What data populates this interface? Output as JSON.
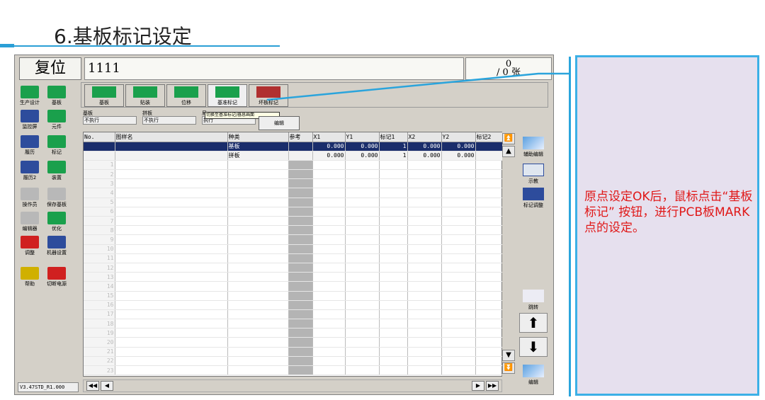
{
  "slide": {
    "title": "6.基板标记设定"
  },
  "topbar": {
    "reset_label": "复位",
    "program_name": "1111",
    "counter_value": "0",
    "counter_unit": "/ 0 张"
  },
  "left_toolbar": [
    {
      "label": "生产设计",
      "icon": "production-design-icon",
      "color": "#1aa04c"
    },
    {
      "label": "基板",
      "icon": "board-icon",
      "color": "#1aa04c"
    },
    {
      "label": "监控屏",
      "icon": "monitor-icon",
      "color": "#2d4c9c"
    },
    {
      "label": "元件",
      "icon": "component-icon",
      "color": "#1aa04c"
    },
    {
      "label": "履历",
      "icon": "history-icon",
      "color": "#2d4c9c"
    },
    {
      "label": "标记",
      "icon": "mark-icon",
      "color": "#1aa04c"
    },
    {
      "label": "履历2",
      "icon": "history2-icon",
      "color": "#2d4c9c"
    },
    {
      "label": "装置",
      "icon": "device-icon",
      "color": "#1aa04c"
    },
    {
      "label": "操作员",
      "icon": "operator-icon",
      "color": "#b8b8b8"
    },
    {
      "label": "保存基板",
      "icon": "save-board-icon",
      "color": "#b8b8b8"
    },
    {
      "label": "编辑器",
      "icon": "editor-icon",
      "color": "#b8b8b8"
    },
    {
      "label": "优化",
      "icon": "optimize-icon",
      "color": "#1aa04c"
    },
    {
      "label": "调整",
      "icon": "adjust-icon",
      "color": "#d02020"
    },
    {
      "label": "机器设置",
      "icon": "machine-settings-icon",
      "color": "#2d4c9c"
    },
    {
      "label": "帮助",
      "icon": "help-icon",
      "color": "#d0b000"
    },
    {
      "label": "切断电源",
      "icon": "power-off-icon",
      "color": "#d02020"
    }
  ],
  "tabs": [
    {
      "label": "基板",
      "icon": "board-tab-icon"
    },
    {
      "label": "贴装",
      "icon": "placement-tab-icon"
    },
    {
      "label": "位移",
      "icon": "offset-tab-icon"
    },
    {
      "label": "基准标记",
      "icon": "fiducial-tab-icon"
    },
    {
      "label": "坏板标记",
      "icon": "bad-mark-tab-icon"
    }
  ],
  "info": {
    "board_label": "基板",
    "board_value": "不执行",
    "panel_label": "拼板",
    "panel_value": "不执行",
    "local_label": "局",
    "local_value": "执行",
    "edit_label": "编辑",
    "tooltip": "切换至基准标记/器息画面"
  },
  "grid": {
    "headers": [
      "No.",
      "图样名",
      "种类",
      "参考",
      "X1",
      "Y1",
      "标记1",
      "X2",
      "Y2",
      "标记2"
    ],
    "rows": [
      [
        "",
        "",
        "基板",
        "",
        "0.000",
        "0.000",
        "1",
        "0.000",
        "0.000",
        ""
      ],
      [
        "",
        "",
        "拼板",
        "",
        "0.000",
        "0.000",
        "1",
        "0.000",
        "0.000",
        ""
      ],
      [
        "1",
        "",
        "",
        "",
        "",
        "",
        "",
        "",
        "",
        ""
      ],
      [
        "2",
        "",
        "",
        "",
        "",
        "",
        "",
        "",
        "",
        ""
      ],
      [
        "3",
        "",
        "",
        "",
        "",
        "",
        "",
        "",
        "",
        ""
      ],
      [
        "4",
        "",
        "",
        "",
        "",
        "",
        "",
        "",
        "",
        ""
      ],
      [
        "5",
        "",
        "",
        "",
        "",
        "",
        "",
        "",
        "",
        ""
      ],
      [
        "6",
        "",
        "",
        "",
        "",
        "",
        "",
        "",
        "",
        ""
      ],
      [
        "7",
        "",
        "",
        "",
        "",
        "",
        "",
        "",
        "",
        ""
      ],
      [
        "8",
        "",
        "",
        "",
        "",
        "",
        "",
        "",
        "",
        ""
      ],
      [
        "9",
        "",
        "",
        "",
        "",
        "",
        "",
        "",
        "",
        ""
      ],
      [
        "10",
        "",
        "",
        "",
        "",
        "",
        "",
        "",
        "",
        ""
      ],
      [
        "11",
        "",
        "",
        "",
        "",
        "",
        "",
        "",
        "",
        ""
      ],
      [
        "12",
        "",
        "",
        "",
        "",
        "",
        "",
        "",
        "",
        ""
      ],
      [
        "13",
        "",
        "",
        "",
        "",
        "",
        "",
        "",
        "",
        ""
      ],
      [
        "14",
        "",
        "",
        "",
        "",
        "",
        "",
        "",
        "",
        ""
      ],
      [
        "15",
        "",
        "",
        "",
        "",
        "",
        "",
        "",
        "",
        ""
      ],
      [
        "16",
        "",
        "",
        "",
        "",
        "",
        "",
        "",
        "",
        ""
      ],
      [
        "17",
        "",
        "",
        "",
        "",
        "",
        "",
        "",
        "",
        ""
      ],
      [
        "18",
        "",
        "",
        "",
        "",
        "",
        "",
        "",
        "",
        ""
      ],
      [
        "19",
        "",
        "",
        "",
        "",
        "",
        "",
        "",
        "",
        ""
      ],
      [
        "20",
        "",
        "",
        "",
        "",
        "",
        "",
        "",
        "",
        ""
      ],
      [
        "21",
        "",
        "",
        "",
        "",
        "",
        "",
        "",
        "",
        ""
      ],
      [
        "22",
        "",
        "",
        "",
        "",
        "",
        "",
        "",
        "",
        ""
      ],
      [
        "23",
        "",
        "",
        "",
        "",
        "",
        "",
        "",
        "",
        ""
      ]
    ]
  },
  "right_buttons": {
    "aux_edit": "辅助编辑",
    "teach": "示教",
    "mark_adjust": "标记调整",
    "jump": "跳转",
    "edit": "编辑"
  },
  "bottom": {
    "version": "V3.47STD_R1.000"
  },
  "note": {
    "text": "原点设定OK后，鼠标点击“基板标记” 按钮，进行PCB板MARK点的设定。"
  },
  "colors": {
    "accent": "#2aa4dc",
    "note_text": "#e01818",
    "note_bg": "#e6e0ee",
    "selected_row": "#1a2d6b"
  }
}
